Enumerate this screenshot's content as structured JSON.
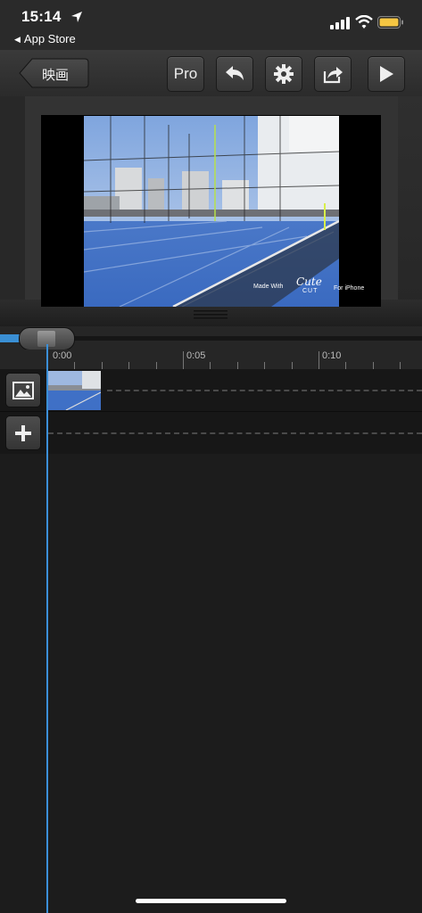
{
  "status_bar": {
    "time": "15:14",
    "back_app": "App Store",
    "icons": [
      "location-arrow-icon",
      "signal-icon",
      "wifi-icon",
      "battery-icon"
    ],
    "battery_color": "#f4c542"
  },
  "toolbar": {
    "back_label": "映画",
    "pro_label": "Pro",
    "buttons": [
      "undo-icon",
      "gear-icon",
      "share-icon",
      "play-icon"
    ]
  },
  "preview": {
    "watermark": {
      "made_with": "Made With",
      "cute": "Cute",
      "cut": "CUT",
      "for_iphone": "For iPhone"
    }
  },
  "timeline": {
    "labels": [
      "0:00",
      "0:05",
      "0:10"
    ],
    "playhead_color": "#3b8fd8"
  },
  "tracks": [
    {
      "button_icon": "image-icon"
    },
    {
      "button_icon": "plus-icon"
    }
  ]
}
